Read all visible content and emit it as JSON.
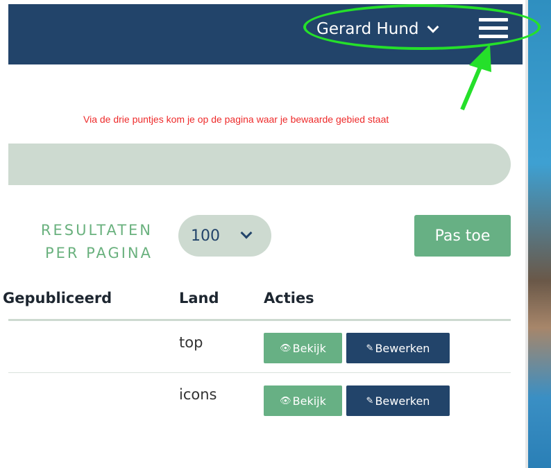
{
  "header": {
    "user_name": "Gerard Hund",
    "chevron_icon": "chevron-down-icon",
    "menu_icon": "hamburger-menu-icon",
    "bg_color": "#22446a"
  },
  "annotation": {
    "text": "Via de drie puntjes kom je op de pagina waar je bewaarde gebied staat",
    "color": "#ee2b2b",
    "highlight_color": "#25e02a"
  },
  "filters": {
    "results_per_page_line1": "RESULTATEN",
    "results_per_page_line2": "PER PAGINA",
    "results_per_page_value": "100",
    "apply_label": "Pas toe"
  },
  "table": {
    "headers": [
      "Gepubliceerd",
      "Land",
      "Acties"
    ],
    "rows": [
      {
        "published": "",
        "land": "top",
        "view_label": "Bekijk",
        "edit_label": "Bewerken"
      },
      {
        "published": "",
        "land": "icons",
        "view_label": "Bekijk",
        "edit_label": "Bewerken"
      }
    ]
  },
  "colors": {
    "accent_green": "#67b084",
    "navy": "#22446a",
    "light_green": "#cddad0"
  }
}
